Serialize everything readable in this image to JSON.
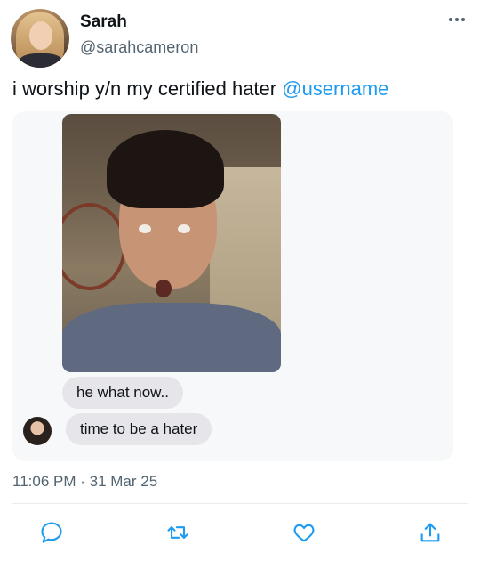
{
  "user": {
    "name": "Sarah",
    "handle": "@sarahcameron"
  },
  "tweet": {
    "text_plain": "i worship y/n my certified hater ",
    "mention": "@username",
    "timestamp": "11:06 PM · 31 Mar 25"
  },
  "chat": {
    "messages": [
      {
        "text": "he what now.."
      },
      {
        "text": "time to be a hater"
      }
    ]
  },
  "icons": {
    "more": "more-icon",
    "reply": "reply-icon",
    "retweet": "retweet-icon",
    "like": "like-icon",
    "share": "share-icon"
  },
  "colors": {
    "accent": "#1d9bf0",
    "secondary_text": "#536471",
    "bubble": "#e5e5ea"
  }
}
